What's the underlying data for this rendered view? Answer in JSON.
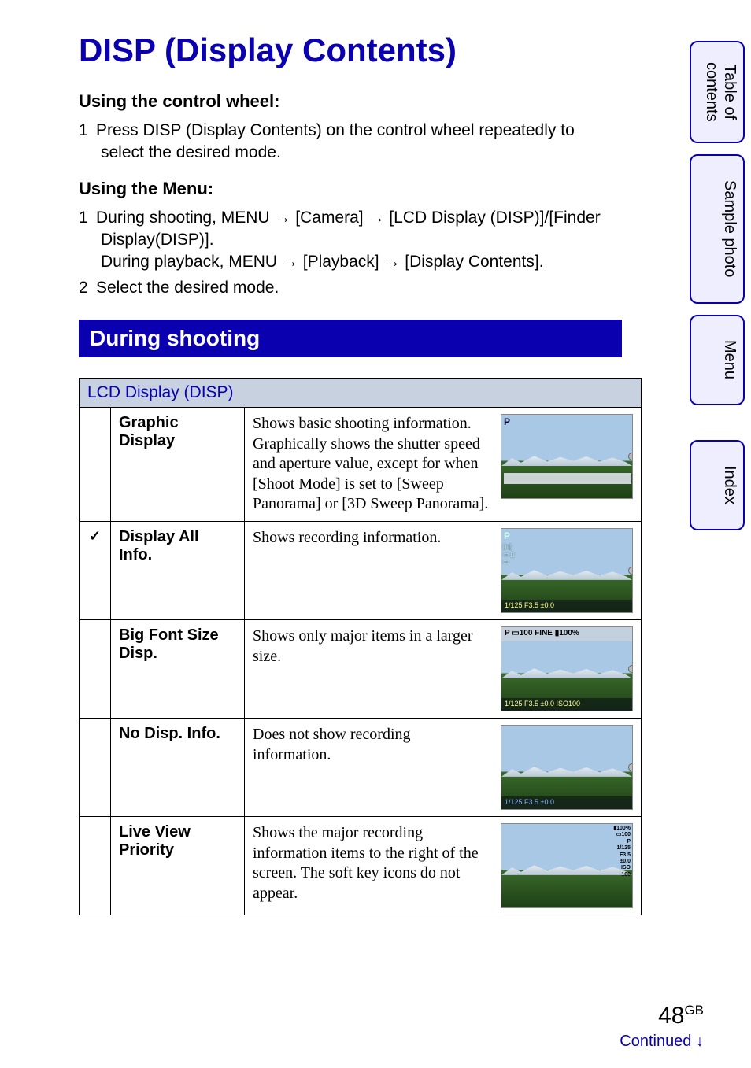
{
  "title": "DISP (Display Contents)",
  "section_shooting": "During shooting",
  "sub_wheel": "Using the control wheel:",
  "sub_menu": "Using the Menu:",
  "arrow": "→",
  "steps_wheel": [
    "Press DISP (Display Contents) on the control wheel repeatedly to select the desired mode."
  ],
  "steps_menu": [
    "During shooting, MENU → [Camera] → [LCD Display (DISP)]/[Finder Display(DISP)].\nDuring playback, MENU → [Playback] → [Display Contents].",
    "Select the desired mode."
  ],
  "table_title": "LCD Display (DISP)",
  "rows": [
    {
      "check": "",
      "name": "Graphic Display",
      "desc": "Shows basic shooting information. Graphically shows the shutter speed and aperture value, except for when [Shoot Mode] is set to [Sweep Panorama] or [3D Sweep Panorama].",
      "thumb": {
        "p": "P",
        "top": "",
        "bot": "",
        "grid": true
      }
    },
    {
      "check": "✓",
      "name": "Display All Info.",
      "desc": "Shows recording information.",
      "thumb": {
        "p": "P",
        "overlay": true,
        "bot": "1/125  F3.5 ±0.0"
      }
    },
    {
      "check": "",
      "name": "Big Font Size Disp.",
      "desc": "Shows only major items in a larger size.",
      "thumb": {
        "bigtop": "P ▭100   FINE   ▮100%",
        "bot": "1/125   F3.5  ±0.0  ISO100"
      }
    },
    {
      "check": "",
      "name": "No Disp. Info.",
      "desc": "Does not show recording information.",
      "thumb": {
        "bot": "1/125  F3.5 ±0.0"
      }
    },
    {
      "check": "",
      "name": "Live View Priority",
      "desc": "Shows the major recording information items to the right of the screen. The soft key icons do not appear.",
      "thumb": {
        "lvp": true,
        "side": "▮100%\n▭100\nP\n1/125\nF3.5\n±0.0\nISO\n100"
      }
    }
  ],
  "tabs": {
    "toc": "Table of contents",
    "sample": "Sample photo",
    "menu": "Menu",
    "index": "Index"
  },
  "page_number": "48",
  "page_suffix": "GB",
  "continued": "Continued ↓"
}
